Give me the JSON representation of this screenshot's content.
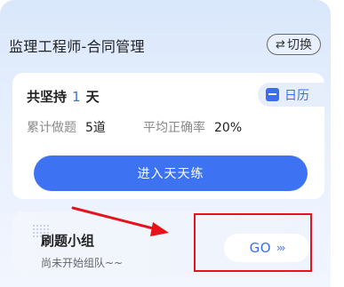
{
  "header": {
    "title": "监理工程师-合同管理",
    "switch_icon": "⇄",
    "switch_label": "切换"
  },
  "progress": {
    "streak_prefix": "共坚持",
    "streak_days": "1",
    "streak_suffix": "天",
    "calendar_label": "日历",
    "total_label": "累计做题",
    "total_value": "5道",
    "accuracy_label": "平均正确率",
    "accuracy_value": "20%",
    "practice_button": "进入天天练"
  },
  "group": {
    "title": "刷题小组",
    "subtitle": "尚未开始组队~~",
    "go_label": "GO",
    "go_chevrons": "›››"
  },
  "colors": {
    "accent": "#3d73f2",
    "annotation": "#e8121c"
  }
}
